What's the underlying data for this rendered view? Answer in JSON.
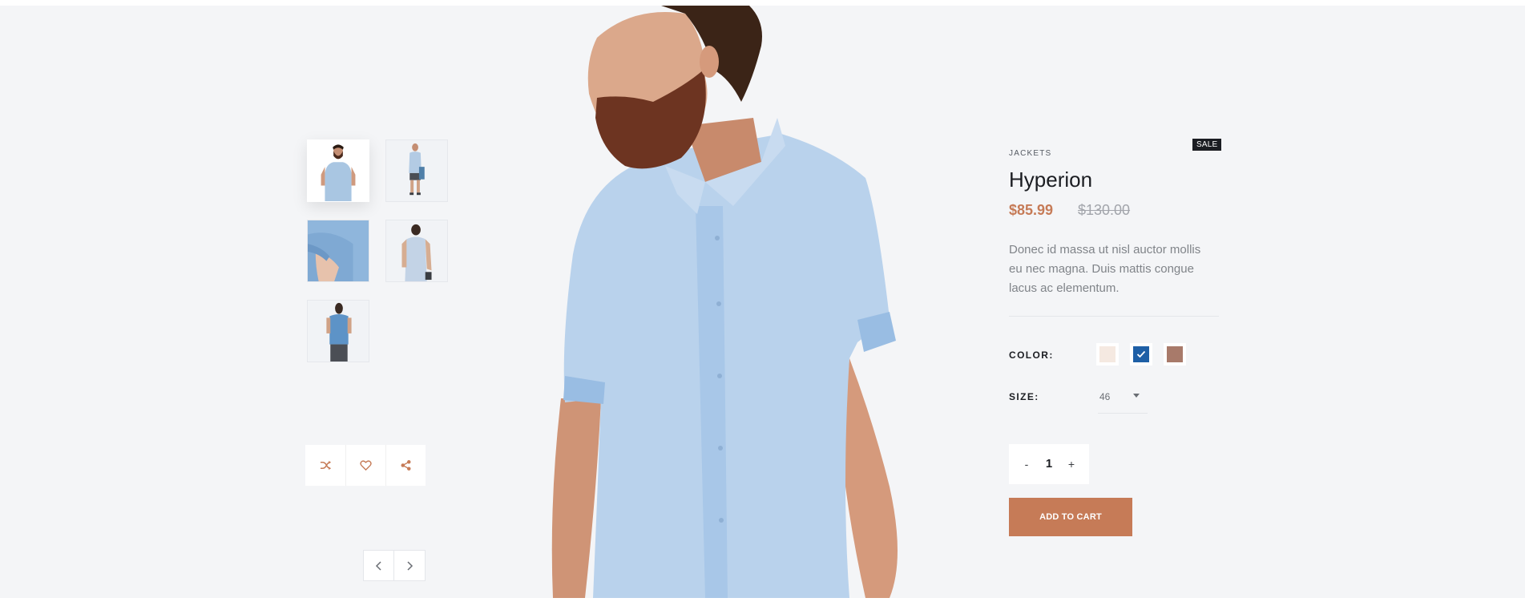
{
  "product": {
    "badge": "SALE",
    "category": "JACKETS",
    "title": "Hyperion",
    "price": "$85.99",
    "old_price": "$130.00",
    "description": "Donec id massa ut nisl auctor mollis eu nec magna. Duis mattis congue lacus ac elementum."
  },
  "options": {
    "color_label": "COLOR:",
    "colors": [
      "#f5e9e1",
      "#1e5fa6",
      "#a87a6a"
    ],
    "selected_color_index": 1,
    "size_label": "SIZE:",
    "size_value": "46"
  },
  "quantity": {
    "minus": "-",
    "value": "1",
    "plus": "+"
  },
  "cart": {
    "label": "ADD TO CART"
  },
  "theme": {
    "accent": "#c67b57",
    "dark": "#1b1d22",
    "background": "#f4f5f7"
  },
  "icons": {
    "actions": [
      "shuffle-icon",
      "heart-icon",
      "share-icon"
    ],
    "pager": [
      "chevron-left-icon",
      "chevron-right-icon"
    ]
  }
}
